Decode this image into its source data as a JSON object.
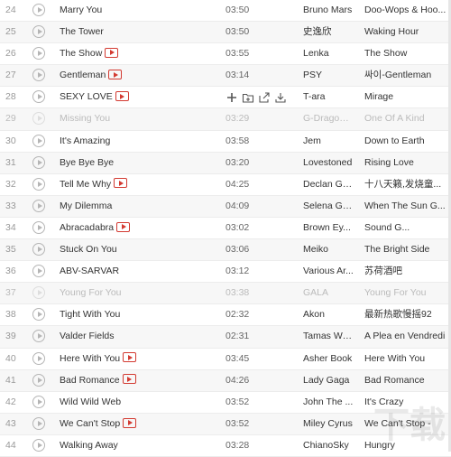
{
  "tracks": [
    {
      "num": "24",
      "title": "Marry You",
      "mv": false,
      "time": "03:50",
      "artist": "Bruno Mars",
      "album": "Doo-Wops & Hoo...",
      "disabled": false
    },
    {
      "num": "25",
      "title": "The Tower",
      "mv": false,
      "time": "03:50",
      "artist": "史逸欣",
      "album": "Waking Hour",
      "disabled": false
    },
    {
      "num": "26",
      "title": "The Show",
      "mv": true,
      "time": "03:55",
      "artist": "Lenka",
      "album": "The Show",
      "disabled": false
    },
    {
      "num": "27",
      "title": "Gentleman",
      "mv": true,
      "time": "03:14",
      "artist": "PSY",
      "album": "싸이-Gentleman",
      "disabled": false
    },
    {
      "num": "28",
      "title": "SEXY LOVE",
      "mv": true,
      "time": "",
      "artist": "T-ara",
      "album": "Mirage",
      "disabled": false,
      "hover": true
    },
    {
      "num": "29",
      "title": "Missing You",
      "mv": false,
      "time": "03:29",
      "artist": "G-Dragon/...",
      "album": "One Of A Kind",
      "disabled": true
    },
    {
      "num": "30",
      "title": "It's Amazing",
      "mv": false,
      "time": "03:58",
      "artist": "Jem",
      "album": "Down to Earth",
      "disabled": false
    },
    {
      "num": "31",
      "title": "Bye Bye Bye",
      "mv": false,
      "time": "03:20",
      "artist": "Lovestoned",
      "album": "Rising Love",
      "disabled": false
    },
    {
      "num": "32",
      "title": "Tell Me Why",
      "mv": true,
      "time": "04:25",
      "artist": "Declan Ga...",
      "album": "十八天籁,发烧童...",
      "disabled": false
    },
    {
      "num": "33",
      "title": "My Dilemma",
      "mv": false,
      "time": "04:09",
      "artist": "Selena Go...",
      "album": "When The Sun G...",
      "disabled": false
    },
    {
      "num": "34",
      "title": "Abracadabra",
      "mv": true,
      "time": "03:02",
      "artist": "Brown Ey...",
      "album": "Sound G...",
      "disabled": false
    },
    {
      "num": "35",
      "title": "Stuck On You",
      "mv": false,
      "time": "03:06",
      "artist": "Meiko",
      "album": "The Bright Side",
      "disabled": false
    },
    {
      "num": "36",
      "title": "ABV-SARVAR",
      "mv": false,
      "time": "03:12",
      "artist": "Various Ar...",
      "album": "苏荷酒吧",
      "disabled": false
    },
    {
      "num": "37",
      "title": "Young For You",
      "mv": false,
      "time": "03:38",
      "artist": "GALA",
      "album": "Young For You",
      "disabled": true
    },
    {
      "num": "38",
      "title": "Tight With You",
      "mv": false,
      "time": "02:32",
      "artist": "Akon",
      "album": "最新热歌慢摇92",
      "disabled": false
    },
    {
      "num": "39",
      "title": "Valder Fields",
      "mv": false,
      "time": "02:31",
      "artist": "Tamas Wells",
      "album": "A Plea en Vendredi",
      "disabled": false
    },
    {
      "num": "40",
      "title": "Here With You",
      "mv": true,
      "time": "03:45",
      "artist": "Asher Book",
      "album": "Here With You",
      "disabled": false
    },
    {
      "num": "41",
      "title": "Bad Romance",
      "mv": true,
      "time": "04:26",
      "artist": "Lady Gaga",
      "album": "Bad Romance",
      "disabled": false
    },
    {
      "num": "42",
      "title": "Wild Wild Web",
      "mv": false,
      "time": "03:52",
      "artist": "John The ...",
      "album": "It's Crazy",
      "disabled": false
    },
    {
      "num": "43",
      "title": "We Can't Stop",
      "mv": true,
      "time": "03:52",
      "artist": "Miley Cyrus",
      "album": "We Can't Stop -",
      "disabled": false
    },
    {
      "num": "44",
      "title": "Walking Away",
      "mv": false,
      "time": "03:28",
      "artist": "ChianoSky",
      "album": "Hungry",
      "disabled": false
    }
  ],
  "row_actions": [
    "add-icon",
    "add-to-folder-icon",
    "share-icon",
    "download-icon"
  ],
  "colors": {
    "mv_icon": "#d33a31",
    "disabled_text": "#bbbbbb",
    "row_alt": "#f7f7f7"
  }
}
